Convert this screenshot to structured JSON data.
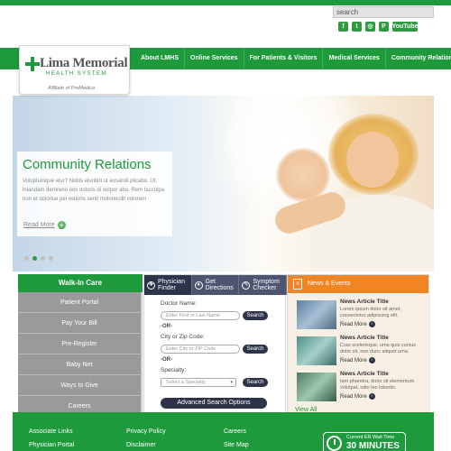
{
  "header": {
    "search_placeholder": "search",
    "social": [
      "f",
      "t",
      "◎",
      "P"
    ],
    "youtube_label": "YouTube"
  },
  "logo": {
    "name": "Lima Memorial",
    "subtitle": "HEALTH SYSTEM",
    "affiliate": "Affiliate of ProMedica"
  },
  "nav": {
    "items": [
      "About LMHS",
      "Online Services",
      "For Patients & Visitors",
      "Medical Services",
      "Community Relations"
    ]
  },
  "hero": {
    "title": "Community Relations",
    "text": "Voluptumque elur? Nobis eiuntint ut eosandi plicabo. Ut, iniandam deroreno eos doloris di oolpor abo. Rem facculpa non et dolorise pel estioris senit moloreicilit volorem",
    "read_more": "Read More"
  },
  "walkin": {
    "title": "Walk-In Care",
    "items": [
      "Patient Portal",
      "Pay Your Bill",
      "Pre-Register",
      "Baby Net",
      "Ways to Give",
      "Careers"
    ]
  },
  "finder": {
    "tabs": [
      "Physician Finder",
      "Get Directions",
      "Symptom Checker"
    ],
    "doctor_label": "Doctor Name:",
    "doctor_placeholder": "Enter First or Last Name",
    "search_label": "Search",
    "or_label": "-OR-",
    "city_label": "City or Zip Code:",
    "city_placeholder": "Enter City or ZIP Code",
    "specialty_label": "Specialty:",
    "specialty_value": "Select a Specialty",
    "advanced_label": "Advanced Search Options"
  },
  "news": {
    "title": "News & Events",
    "articles": [
      {
        "title": "News Article Title",
        "text": "Lorem ipsum dolor sit amet, consectetur adipiscing elit.",
        "more": "Read More"
      },
      {
        "title": "News Article Title",
        "text": "Cras scelerisque, uma quis cursus dolor sit, non dunc aliquet uma.",
        "more": "Read More"
      },
      {
        "title": "News Article Title",
        "text": "Iam pharetra, dolor sit elementum volutpat, odio leo lobortis.",
        "more": "Read More"
      }
    ],
    "view_all": "View All"
  },
  "footer": {
    "links": [
      "Associate Links",
      "Privacy Policy",
      "Careers",
      "Physician Portal",
      "Disclaimer",
      "Site Map"
    ],
    "wait_label": "Current ER Wait Time",
    "wait_value": "30 MINUTES"
  },
  "colors": {
    "brand_green": "#1e9a3c",
    "news_orange": "#f08526",
    "finder_navy": "#2d3348"
  }
}
